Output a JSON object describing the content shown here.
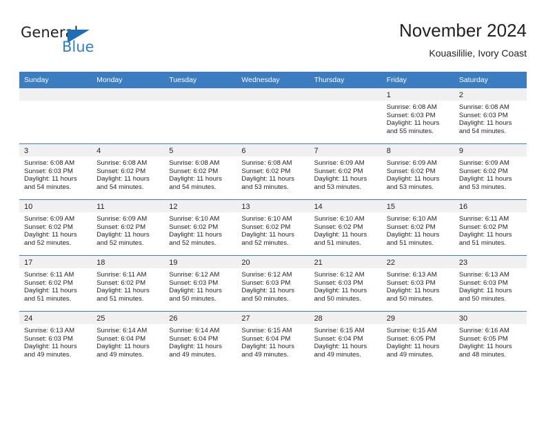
{
  "brand": {
    "name_part1": "General",
    "name_part2": "Blue",
    "accent_color": "#2f7fc5",
    "triangle_color": "#1d6fb8"
  },
  "header": {
    "title": "November 2024",
    "subtitle": "Kouasililie, Ivory Coast"
  },
  "calendar": {
    "header_bg": "#3b7dc0",
    "daynum_bg": "#f0f0f0",
    "weekdays": [
      "Sunday",
      "Monday",
      "Tuesday",
      "Wednesday",
      "Thursday",
      "Friday",
      "Saturday"
    ],
    "labels": {
      "sunrise": "Sunrise:",
      "sunset": "Sunset:",
      "daylight": "Daylight:"
    },
    "weeks": [
      [
        {
          "day": "",
          "empty": true
        },
        {
          "day": "",
          "empty": true
        },
        {
          "day": "",
          "empty": true
        },
        {
          "day": "",
          "empty": true
        },
        {
          "day": "",
          "empty": true
        },
        {
          "day": "1",
          "sunrise": "Sunrise: 6:08 AM",
          "sunset": "Sunset: 6:03 PM",
          "daylight": "Daylight: 11 hours and 55 minutes."
        },
        {
          "day": "2",
          "sunrise": "Sunrise: 6:08 AM",
          "sunset": "Sunset: 6:03 PM",
          "daylight": "Daylight: 11 hours and 54 minutes."
        }
      ],
      [
        {
          "day": "3",
          "sunrise": "Sunrise: 6:08 AM",
          "sunset": "Sunset: 6:03 PM",
          "daylight": "Daylight: 11 hours and 54 minutes."
        },
        {
          "day": "4",
          "sunrise": "Sunrise: 6:08 AM",
          "sunset": "Sunset: 6:02 PM",
          "daylight": "Daylight: 11 hours and 54 minutes."
        },
        {
          "day": "5",
          "sunrise": "Sunrise: 6:08 AM",
          "sunset": "Sunset: 6:02 PM",
          "daylight": "Daylight: 11 hours and 54 minutes."
        },
        {
          "day": "6",
          "sunrise": "Sunrise: 6:08 AM",
          "sunset": "Sunset: 6:02 PM",
          "daylight": "Daylight: 11 hours and 53 minutes."
        },
        {
          "day": "7",
          "sunrise": "Sunrise: 6:09 AM",
          "sunset": "Sunset: 6:02 PM",
          "daylight": "Daylight: 11 hours and 53 minutes."
        },
        {
          "day": "8",
          "sunrise": "Sunrise: 6:09 AM",
          "sunset": "Sunset: 6:02 PM",
          "daylight": "Daylight: 11 hours and 53 minutes."
        },
        {
          "day": "9",
          "sunrise": "Sunrise: 6:09 AM",
          "sunset": "Sunset: 6:02 PM",
          "daylight": "Daylight: 11 hours and 53 minutes."
        }
      ],
      [
        {
          "day": "10",
          "sunrise": "Sunrise: 6:09 AM",
          "sunset": "Sunset: 6:02 PM",
          "daylight": "Daylight: 11 hours and 52 minutes."
        },
        {
          "day": "11",
          "sunrise": "Sunrise: 6:09 AM",
          "sunset": "Sunset: 6:02 PM",
          "daylight": "Daylight: 11 hours and 52 minutes."
        },
        {
          "day": "12",
          "sunrise": "Sunrise: 6:10 AM",
          "sunset": "Sunset: 6:02 PM",
          "daylight": "Daylight: 11 hours and 52 minutes."
        },
        {
          "day": "13",
          "sunrise": "Sunrise: 6:10 AM",
          "sunset": "Sunset: 6:02 PM",
          "daylight": "Daylight: 11 hours and 52 minutes."
        },
        {
          "day": "14",
          "sunrise": "Sunrise: 6:10 AM",
          "sunset": "Sunset: 6:02 PM",
          "daylight": "Daylight: 11 hours and 51 minutes."
        },
        {
          "day": "15",
          "sunrise": "Sunrise: 6:10 AM",
          "sunset": "Sunset: 6:02 PM",
          "daylight": "Daylight: 11 hours and 51 minutes."
        },
        {
          "day": "16",
          "sunrise": "Sunrise: 6:11 AM",
          "sunset": "Sunset: 6:02 PM",
          "daylight": "Daylight: 11 hours and 51 minutes."
        }
      ],
      [
        {
          "day": "17",
          "sunrise": "Sunrise: 6:11 AM",
          "sunset": "Sunset: 6:02 PM",
          "daylight": "Daylight: 11 hours and 51 minutes."
        },
        {
          "day": "18",
          "sunrise": "Sunrise: 6:11 AM",
          "sunset": "Sunset: 6:02 PM",
          "daylight": "Daylight: 11 hours and 51 minutes."
        },
        {
          "day": "19",
          "sunrise": "Sunrise: 6:12 AM",
          "sunset": "Sunset: 6:03 PM",
          "daylight": "Daylight: 11 hours and 50 minutes."
        },
        {
          "day": "20",
          "sunrise": "Sunrise: 6:12 AM",
          "sunset": "Sunset: 6:03 PM",
          "daylight": "Daylight: 11 hours and 50 minutes."
        },
        {
          "day": "21",
          "sunrise": "Sunrise: 6:12 AM",
          "sunset": "Sunset: 6:03 PM",
          "daylight": "Daylight: 11 hours and 50 minutes."
        },
        {
          "day": "22",
          "sunrise": "Sunrise: 6:13 AM",
          "sunset": "Sunset: 6:03 PM",
          "daylight": "Daylight: 11 hours and 50 minutes."
        },
        {
          "day": "23",
          "sunrise": "Sunrise: 6:13 AM",
          "sunset": "Sunset: 6:03 PM",
          "daylight": "Daylight: 11 hours and 50 minutes."
        }
      ],
      [
        {
          "day": "24",
          "sunrise": "Sunrise: 6:13 AM",
          "sunset": "Sunset: 6:03 PM",
          "daylight": "Daylight: 11 hours and 49 minutes."
        },
        {
          "day": "25",
          "sunrise": "Sunrise: 6:14 AM",
          "sunset": "Sunset: 6:04 PM",
          "daylight": "Daylight: 11 hours and 49 minutes."
        },
        {
          "day": "26",
          "sunrise": "Sunrise: 6:14 AM",
          "sunset": "Sunset: 6:04 PM",
          "daylight": "Daylight: 11 hours and 49 minutes."
        },
        {
          "day": "27",
          "sunrise": "Sunrise: 6:15 AM",
          "sunset": "Sunset: 6:04 PM",
          "daylight": "Daylight: 11 hours and 49 minutes."
        },
        {
          "day": "28",
          "sunrise": "Sunrise: 6:15 AM",
          "sunset": "Sunset: 6:04 PM",
          "daylight": "Daylight: 11 hours and 49 minutes."
        },
        {
          "day": "29",
          "sunrise": "Sunrise: 6:15 AM",
          "sunset": "Sunset: 6:05 PM",
          "daylight": "Daylight: 11 hours and 49 minutes."
        },
        {
          "day": "30",
          "sunrise": "Sunrise: 6:16 AM",
          "sunset": "Sunset: 6:05 PM",
          "daylight": "Daylight: 11 hours and 48 minutes."
        }
      ]
    ]
  }
}
